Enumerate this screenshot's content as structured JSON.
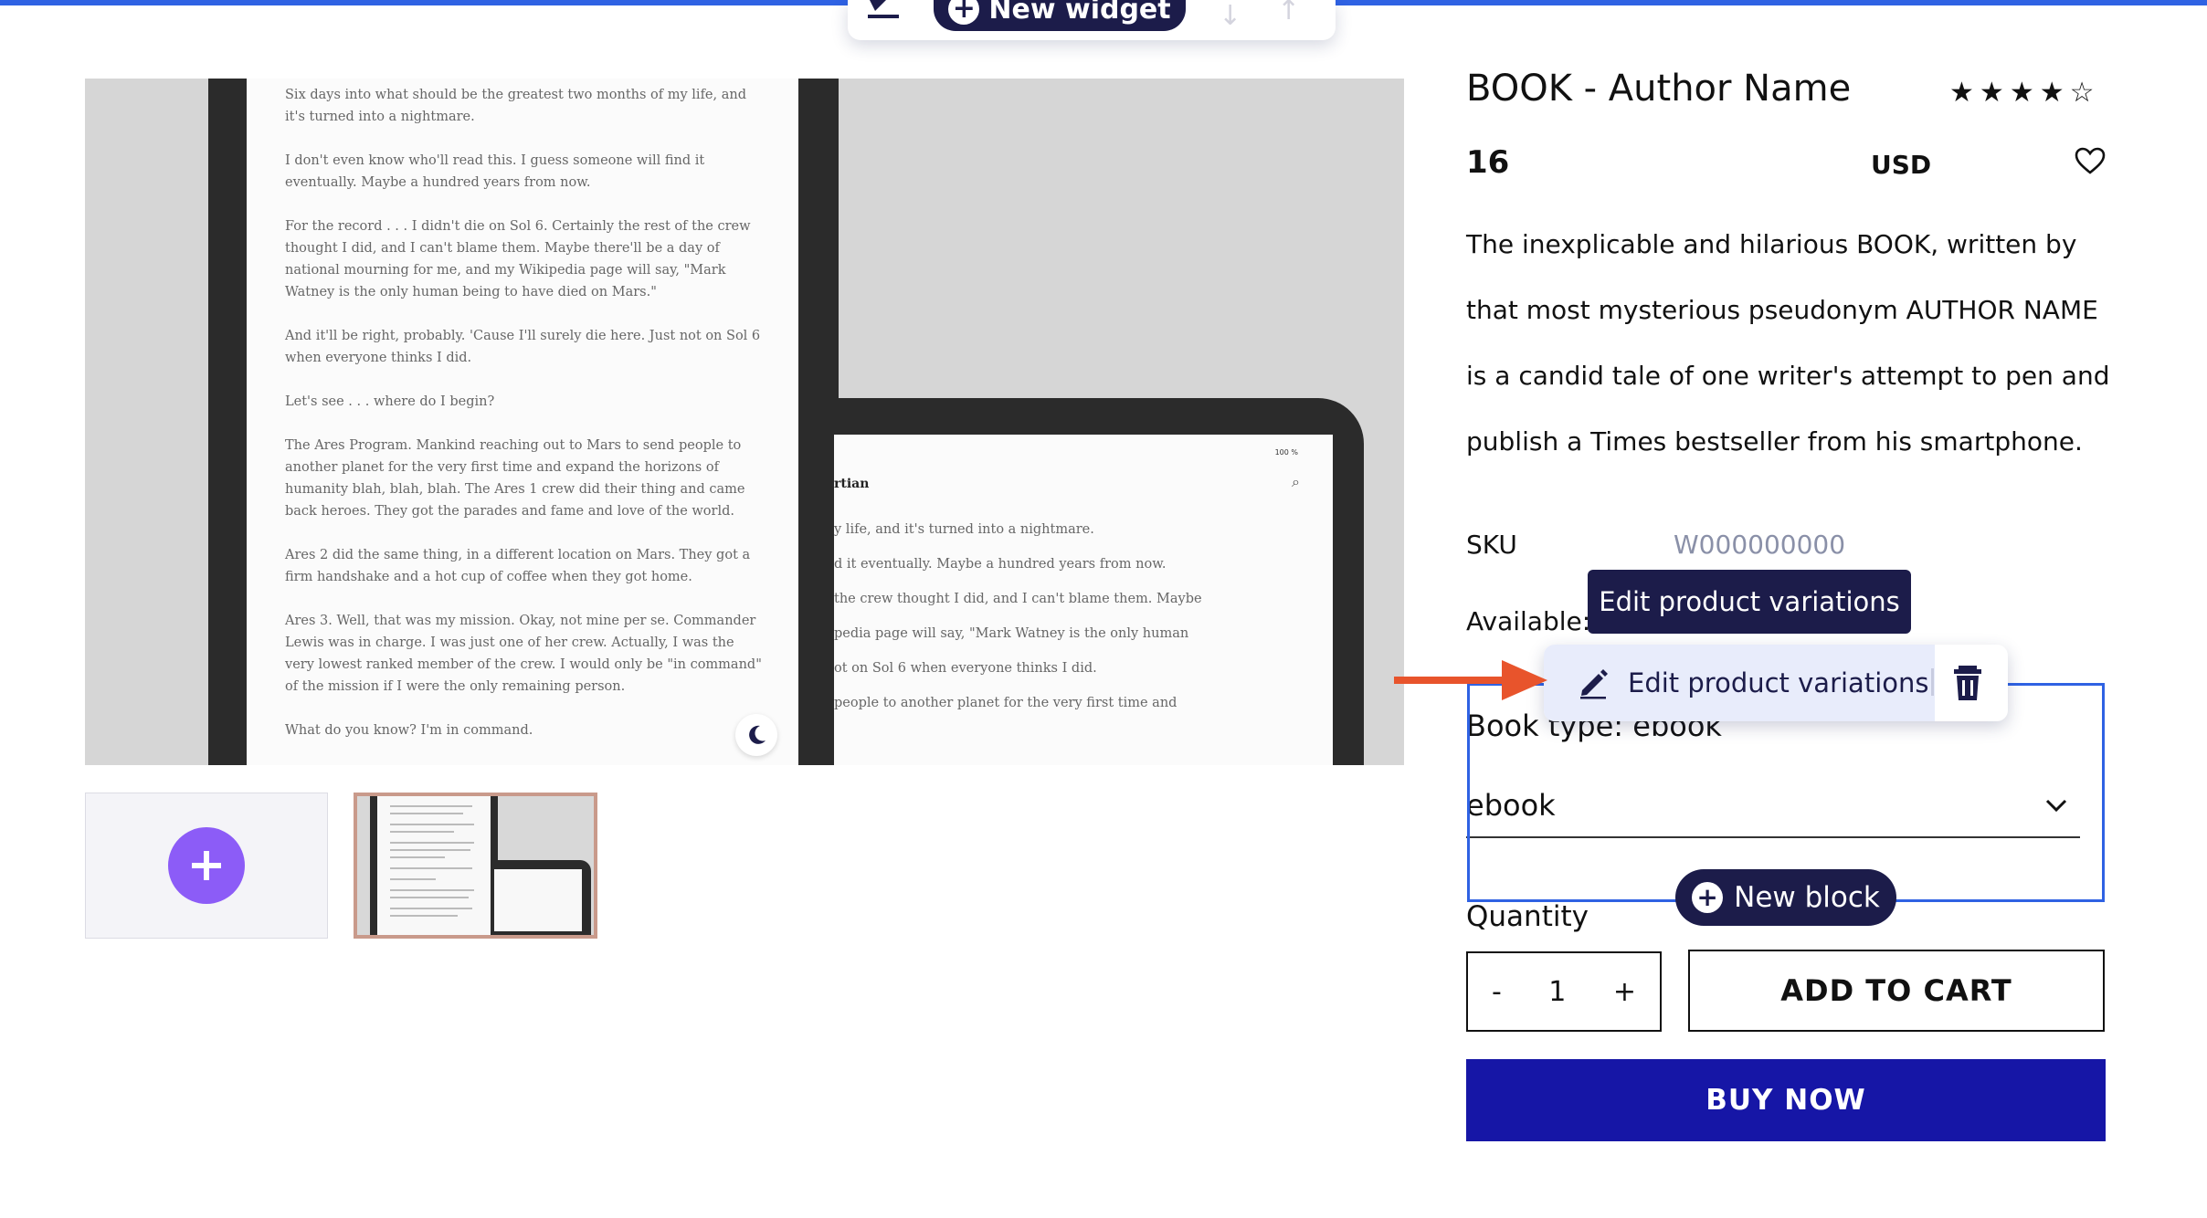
{
  "widget_toolbar": {
    "new_widget_label": "New widget",
    "icons": [
      "edit-icon",
      "plus-icon",
      "arrow-down-icon",
      "arrow-up-icon"
    ]
  },
  "gallery": {
    "phone_paragraphs": [
      "Six days into what should be the greatest two months of my life, and it's turned into a nightmare.",
      "I don't even know who'll read this. I guess someone will find it eventually. Maybe a hundred years from now.",
      "For the record . . . I didn't die on Sol 6. Certainly the rest of the crew thought I did, and I can't blame them. Maybe there'll be a day of national mourning for me, and my Wikipedia page will say, \"Mark Watney is the only human being to have died on Mars.\"",
      "And it'll be right, probably. 'Cause I'll surely die here. Just not on Sol 6 when everyone thinks I did.",
      "Let's see . . . where do I begin?",
      "The Ares Program. Mankind reaching out to Mars to send people to another planet for the very first time and expand the horizons of humanity blah, blah, blah. The Ares 1 crew did their thing and came back heroes. They got the parades and fame and love of the world.",
      "Ares 2 did the same thing, in a different location on Mars. They got a firm handshake and a hot cup of coffee when they got home.",
      "Ares 3. Well, that was my mission. Okay, not mine per se. Commander Lewis was in charge. I was just one of her crew. Actually, I was the very lowest ranked member of the crew. I would only be \"in command\" of the mission if I were the only remaining person.",
      "What do you know? I'm in command."
    ],
    "tablet_status": "100 %",
    "tablet_title": "rtian",
    "tablet_lines": [
      "y life, and it's turned into a nightmare.",
      "d it eventually. Maybe a hundred years from now.",
      "the crew thought I did, and I can't blame them. Maybe",
      "pedia page will say, \"Mark Watney is the only human",
      "ot on Sol 6 when everyone thinks I did.",
      "people to another planet for the very first time and"
    ],
    "icons": [
      "moon-icon",
      "add-image-icon",
      "search-icon"
    ]
  },
  "product": {
    "title": "BOOK - Author Name",
    "rating": 4,
    "rating_max": 5,
    "price": "16",
    "currency": "USD",
    "description": "The inexplicable and hilarious BOOK, written by that most mysterious pseudonym AUTHOR NAME is a candid tale of one writer's attempt to pen and publish a Times bestseller from his smartphone.",
    "sku_label": "SKU",
    "sku_value": "W000000000",
    "available_label": "Available:",
    "book_type_label": "Book type: ebook",
    "book_type_value": "ebook",
    "quantity_label": "Quantity",
    "quantity_value": "1",
    "qty_minus": "-",
    "qty_plus": "+",
    "add_to_cart_label": "ADD TO CART",
    "buy_now_label": "BUY NOW"
  },
  "editor": {
    "tooltip_label": "Edit product variations",
    "block_edit_label": "Edit product variations",
    "new_block_label": "New block",
    "icons": [
      "pencil-icon",
      "trash-icon",
      "arrow-right-icon",
      "heart-icon",
      "chevron-down-icon"
    ]
  },
  "colors": {
    "accent_blue": "#2f62e3",
    "editor_navy": "#1c1c4a",
    "buy_now_blue": "#1616a6",
    "add_purple": "#8c5cf7",
    "arrow_orange": "#e8542c",
    "sku_gray": "#8a90a8"
  }
}
